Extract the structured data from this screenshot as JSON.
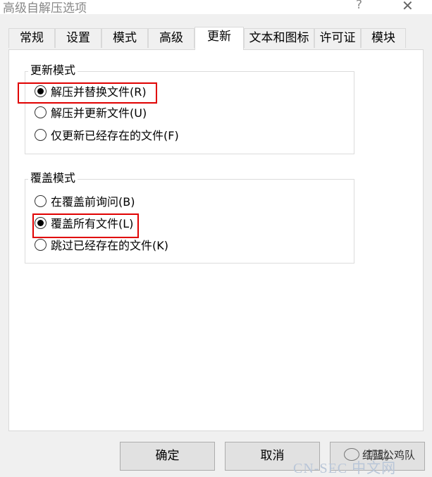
{
  "window": {
    "title": "高级自解压选项",
    "help_glyph": "?",
    "close_glyph": "✕"
  },
  "tabs": [
    {
      "label": "常规",
      "active": false
    },
    {
      "label": "设置",
      "active": false
    },
    {
      "label": "模式",
      "active": false
    },
    {
      "label": "高级",
      "active": false
    },
    {
      "label": "更新",
      "active": true
    },
    {
      "label": "文本和图标",
      "active": false
    },
    {
      "label": "许可证",
      "active": false
    },
    {
      "label": "模块",
      "active": false
    }
  ],
  "update_mode": {
    "title": "更新模式",
    "options": [
      {
        "label": "解压并替换文件(R)",
        "checked": true
      },
      {
        "label": "解压并更新文件(U)",
        "checked": false
      },
      {
        "label": "仅更新已经存在的文件(F)",
        "checked": false
      }
    ]
  },
  "overwrite_mode": {
    "title": "覆盖模式",
    "options": [
      {
        "label": "在覆盖前询问(B)",
        "checked": false
      },
      {
        "label": "覆盖所有文件(L)",
        "checked": true
      },
      {
        "label": "跳过已经存在的文件(K)",
        "checked": false
      }
    ]
  },
  "buttons": {
    "ok": "确定",
    "cancel": "取消",
    "help": "帮助"
  },
  "watermark": {
    "account": "红蓝公鸡队",
    "site": "CN-SEC 中文网"
  },
  "highlight_color": "#e00000"
}
